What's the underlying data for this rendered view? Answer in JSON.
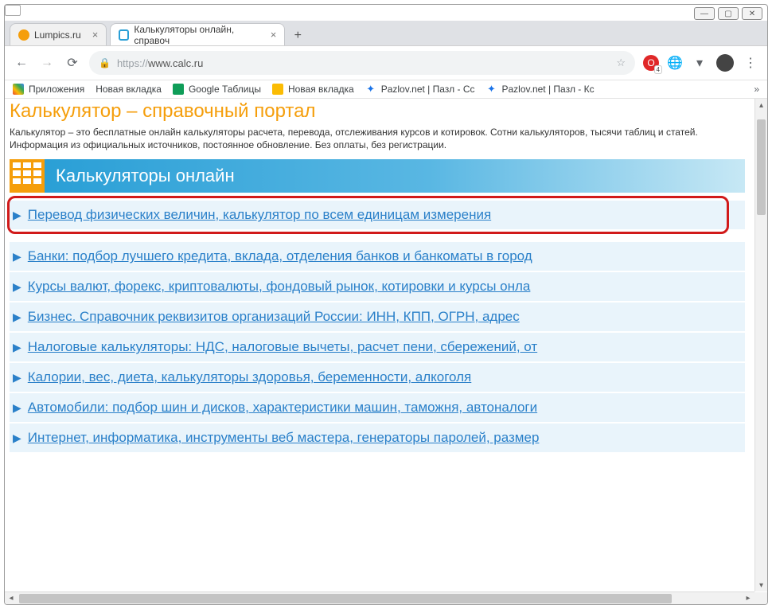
{
  "window": {
    "min": "—",
    "max": "▢",
    "close": "✕"
  },
  "tabs": {
    "tab0": {
      "title": "Lumpics.ru"
    },
    "tab1": {
      "title": "Калькуляторы онлайн, справоч"
    }
  },
  "address": {
    "scheme": "https://",
    "host": "www.calc.ru",
    "opera_badge": "4"
  },
  "bookmarks": {
    "apps": "Приложения",
    "newtab1": "Новая вкладка",
    "sheets": "Google Таблицы",
    "newtab2": "Новая вкладка",
    "pazlov1": "Pazlov.net | Пазл - Сс",
    "pazlov2": "Pazlov.net | Пазл - Кс"
  },
  "page": {
    "h1": "Калькулятор – справочный портал",
    "desc": "Калькулятор – это бесплатные онлайн калькуляторы расчета, перевода, отслеживания курсов и котировок. Сотни калькуляторов, тысячи таблиц и статей. Информация из официальных источников, постоянное обновление. Без оплаты, без регистрации.",
    "section_title": "Калькуляторы онлайн",
    "cats": [
      "Перевод физических величин, калькулятор по всем единицам измерения",
      "Банки: подбор лучшего кредита, вклада, отделения банков и банкоматы в город",
      "Курсы валют, форекс, криптовалюты, фондовый рынок, котировки и курсы онла",
      "Бизнес. Справочник реквизитов организаций России: ИНН, КПП, ОГРН, адрес",
      "Налоговые калькуляторы: НДС, налоговые вычеты, расчет пени, сбережений, от",
      "Калории, вес, диета, калькуляторы здоровья, беременности, алкоголя",
      "Автомобили: подбор шин и дисков, характеристики машин, таможня, автоналоги",
      "Интернет, информатика, инструменты веб мастера, генераторы паролей, размер"
    ]
  }
}
